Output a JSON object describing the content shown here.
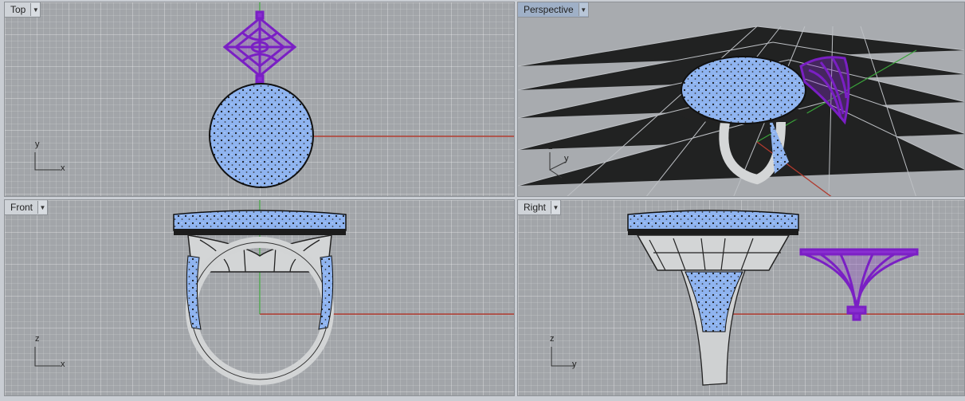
{
  "viewports": {
    "top": {
      "label": "Top",
      "axis_a": "y",
      "axis_b": "x"
    },
    "persp": {
      "label": "Perspective",
      "axis_a": "z",
      "axis_b": "y",
      "axis_c": "x"
    },
    "front": {
      "label": "Front",
      "axis_a": "z",
      "axis_b": "x"
    },
    "right": {
      "label": "Right",
      "axis_a": "z",
      "axis_b": "y"
    }
  },
  "icons": {
    "dropdown": "chevron-down-icon"
  },
  "colors": {
    "grid_bg": "#a2a5a9",
    "stones": "#8fb4f0",
    "metal": "#c9cbcc",
    "purple_part": "#8a2fd1",
    "x_axis": "#b03a2e",
    "y_axis": "#3aa33a"
  }
}
